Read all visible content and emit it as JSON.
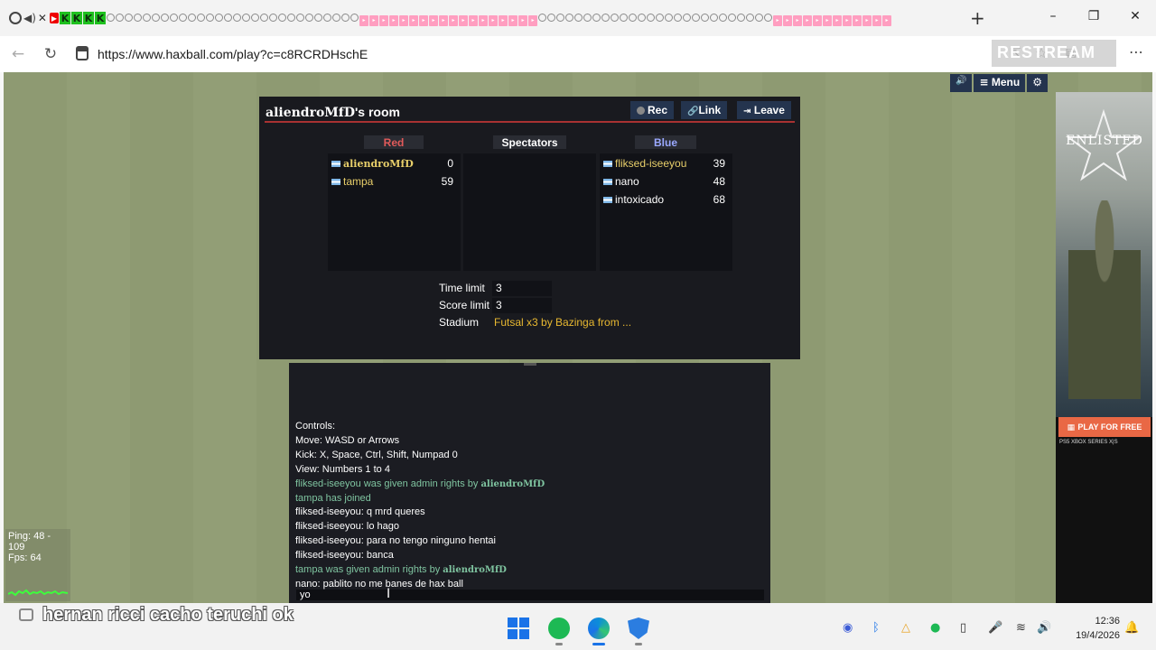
{
  "browser": {
    "url": "https://www.haxball.com/play?c=c8RCRDHschE",
    "restream_label": "RESTREAM",
    "tab_strip": {
      "k_labels": [
        "K",
        "K",
        "K",
        "K"
      ],
      "ring_tabs": 28,
      "pink_tabs": 18,
      "more_ring_tabs": 26,
      "final_pink_tabs": 12
    }
  },
  "game_controls": {
    "menu_label": "Menu"
  },
  "room": {
    "host": "aliendroMfD",
    "title_suffix": "'s room",
    "buttons": {
      "rec": "Rec",
      "link": "Link",
      "leave": "Leave"
    },
    "teams": {
      "red": {
        "label": "Red",
        "players": [
          {
            "name": "aliendroMfD",
            "score": "0"
          },
          {
            "name": "tampa",
            "score": "59"
          }
        ]
      },
      "spectators": {
        "label": "Spectators"
      },
      "blue": {
        "label": "Blue",
        "players": [
          {
            "name": "fliksed-iseeyou",
            "score": "39"
          },
          {
            "name": "nano",
            "score": "48"
          },
          {
            "name": "intoxicado",
            "score": "68"
          }
        ]
      }
    },
    "settings": {
      "time_limit_label": "Time limit",
      "time_limit": "3",
      "score_limit_label": "Score limit",
      "score_limit": "3",
      "stadium_label": "Stadium",
      "stadium": "Futsal x3 by Bazinga from ..."
    }
  },
  "chat": {
    "lines": [
      {
        "text": "Controls:",
        "type": "normal"
      },
      {
        "text": "Move: WASD or Arrows",
        "type": "normal"
      },
      {
        "text": "Kick: X, Space, Ctrl, Shift, Numpad 0",
        "type": "normal"
      },
      {
        "text": "View: Numbers 1 to 4",
        "type": "normal"
      },
      {
        "text": "fliksed-iseeyou was given admin rights by ",
        "styled_name": "aliendroMfD",
        "type": "sys"
      },
      {
        "text": "tampa has joined",
        "type": "sys"
      },
      {
        "text": "fliksed-iseeyou: q mrd queres",
        "type": "normal"
      },
      {
        "text": "fliksed-iseeyou: lo hago",
        "type": "normal"
      },
      {
        "text": "fliksed-iseeyou: para no tengo ninguno hentai",
        "type": "normal"
      },
      {
        "text": "fliksed-iseeyou: banca",
        "type": "normal"
      },
      {
        "text": "tampa was given admin rights by ",
        "styled_name": "aliendroMfD",
        "type": "sys"
      },
      {
        "text": "nano: pablito no me banes de hax ball",
        "type": "normal"
      }
    ],
    "input_value": "yo"
  },
  "stats": {
    "ping": "Ping: 48 - 109",
    "fps": "Fps: 64"
  },
  "ad": {
    "title": "ENLISTED",
    "cta": "PLAY FOR FREE",
    "platforms": "PS5   XBOX SERIES X|S"
  },
  "caption": "hernan ricci cacho teruchi ok",
  "taskbar": {
    "time": "12:36",
    "date": "19/4/2026"
  },
  "colors": {
    "red_team": "#e05a5a",
    "blue_team": "#9aa8ff",
    "panel_bg": "#191a1f",
    "field_green": "#8e9a72",
    "button_bg": "#24344e"
  }
}
